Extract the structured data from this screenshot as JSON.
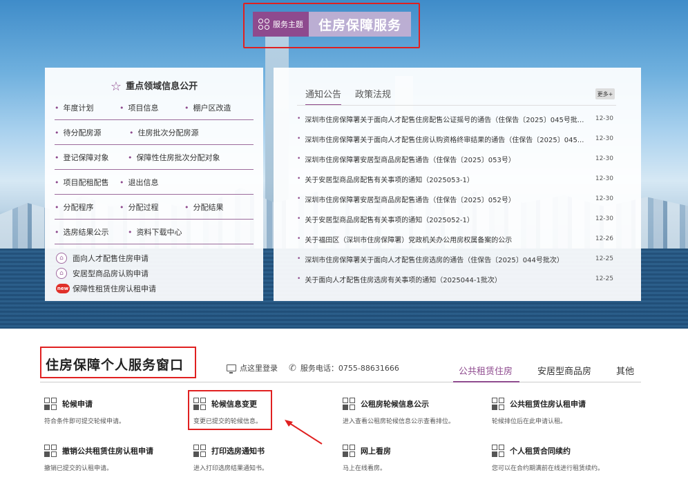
{
  "theme": {
    "tag": "服务主题",
    "title": "住房保障服务"
  },
  "focus_panel": {
    "title": "重点领域信息公开",
    "rows": [
      [
        "年度计划",
        "项目信息",
        "棚户区改造"
      ],
      [
        "待分配房源",
        "住房批次分配房源"
      ],
      [
        "登记保障对象",
        "保障性住房批次分配对象"
      ],
      [
        "项目配租配售",
        "退出信息"
      ],
      [
        "分配程序",
        "分配过程",
        "分配结果"
      ],
      [
        "选房结果公示",
        "资料下载中心"
      ]
    ],
    "links": [
      {
        "label": "面向人才配售住房申请",
        "icon": "house-circle-icon"
      },
      {
        "label": "安居型商品房认购申请",
        "icon": "house-circle-icon"
      },
      {
        "label": "保障性租赁住房认租申请",
        "icon": "new-badge-icon",
        "badge": "new"
      }
    ]
  },
  "news_panel": {
    "tabs": [
      "通知公告",
      "政策法规"
    ],
    "more": "更多+",
    "items": [
      {
        "title": "深圳市住房保障署关于面向人才配售住房配售公证摇号的通告（住保告〔2025〕045号批...",
        "date": "12-30"
      },
      {
        "title": "深圳市住房保障署关于面向人才配售住房认购资格终审结果的通告（住保告〔2025〕045...",
        "date": "12-30"
      },
      {
        "title": "深圳市住房保障署安居型商品房配售通告（住保告〔2025〕053号）",
        "date": "12-30"
      },
      {
        "title": "关于安居型商品房配售有关事项的通知（2025053-1）",
        "date": "12-30"
      },
      {
        "title": "深圳市住房保障署安居型商品房配售通告（住保告〔2025〕052号）",
        "date": "12-30"
      },
      {
        "title": "关于安居型商品房配售有关事项的通知（2025052-1）",
        "date": "12-30"
      },
      {
        "title": "关于福田区（深圳市住房保障署）党政机关办公用房权属备案的公示",
        "date": "12-26"
      },
      {
        "title": "深圳市住房保障署关于面向人才配售住房选房的通告（住保告〔2025〕044号批次）",
        "date": "12-25"
      },
      {
        "title": "关于面向人才配售住房选房有关事项的通知（2025044-1批次）",
        "date": "12-25"
      }
    ]
  },
  "service_window": {
    "title": "住房保障个人服务窗口",
    "login": "点这里登录",
    "phone": "服务电话：0755-88631666",
    "tabs": [
      "公共租赁住房",
      "安居型商品房",
      "其他"
    ],
    "active_tab": "公共租赁住房",
    "items": [
      {
        "name": "轮候申请",
        "desc": "符合条件即可提交轮候申请。"
      },
      {
        "name": "轮候信息变更",
        "desc": "变更已提交的轮候信息。"
      },
      {
        "name": "公租房轮候信息公示",
        "desc": "进入查看公租房轮候信息公示查看排位。"
      },
      {
        "name": "公共租赁住房认租申请",
        "desc": "轮候排位后在此申请认租。"
      },
      {
        "name": "撤销公共租赁住房认租申请",
        "desc": "撤销已提交的认租申请。"
      },
      {
        "name": "打印选房通知书",
        "desc": "进入打印选房结果通知书。"
      },
      {
        "name": "网上看房",
        "desc": "马上在线看房。"
      },
      {
        "name": "个人租赁合同续约",
        "desc": "您可以在合约期满前在线进行租赁续约。"
      }
    ]
  },
  "colors": {
    "accent": "#8e4a8e",
    "highlight": "#e02020"
  }
}
